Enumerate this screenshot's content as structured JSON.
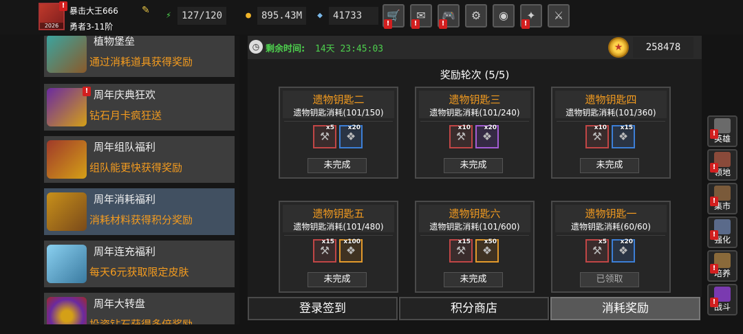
{
  "player": {
    "name": "暴击大王666",
    "rank": "勇者3-11阶",
    "avatar_badge": "2026",
    "energy": "127/120",
    "gold": "895.43M",
    "gems": "41733"
  },
  "top_menu": [
    {
      "icon": "shop-cart-icon",
      "glyph": "🛒",
      "alert": true
    },
    {
      "icon": "mail-icon",
      "glyph": "✉",
      "alert": true
    },
    {
      "icon": "gamepad-icon",
      "glyph": "🎮",
      "alert": true
    },
    {
      "icon": "settings-gear-icon",
      "glyph": "⚙",
      "alert": false
    },
    {
      "icon": "camera-shutter-icon",
      "glyph": "◉",
      "alert": false
    },
    {
      "icon": "fireworks-icon",
      "glyph": "✦",
      "alert": true
    },
    {
      "icon": "crossed-swords-icon",
      "glyph": "⚔",
      "alert": false
    }
  ],
  "events": [
    {
      "title": "植物堡垒",
      "desc": "通过消耗道具获得奖励",
      "thumb": "vase-icon",
      "alert": false,
      "active": false
    },
    {
      "title": "周年庆典狂欢",
      "desc": "钻石月卡疯狂送",
      "thumb": "purple-card-icon",
      "alert": true,
      "active": false
    },
    {
      "title": "周年组队福利",
      "desc": "组队能更快获得奖励",
      "thumb": "treasure-chest-icon",
      "alert": false,
      "active": false
    },
    {
      "title": "周年消耗福利",
      "desc": "消耗材料获得积分奖励",
      "thumb": "gold-chest-icon",
      "alert": false,
      "active": true
    },
    {
      "title": "周年连充福利",
      "desc": "每天6元获取限定皮肤",
      "thumb": "ice-crystal-icon",
      "alert": false,
      "active": false
    },
    {
      "title": "周年大转盘",
      "desc": "投资钻石获得多倍奖励",
      "thumb": "wheel-icon",
      "alert": false,
      "active": false
    }
  ],
  "timer": {
    "label": "剩余时间:",
    "value": "14天 23:45:03"
  },
  "coins": "258478",
  "round_title": "奖励轮次 (5/5)",
  "cards": [
    {
      "name": "遗物钥匙二",
      "progress": "遗物钥匙消耗(101/150)",
      "r1_qty": "x5",
      "r2_qty": "x20",
      "r2_style": "blue",
      "status": "未完成",
      "done": false
    },
    {
      "name": "遗物钥匙三",
      "progress": "遗物钥匙消耗(101/240)",
      "r1_qty": "x10",
      "r2_qty": "x20",
      "r2_style": "purple",
      "status": "未完成",
      "done": false
    },
    {
      "name": "遗物钥匙四",
      "progress": "遗物钥匙消耗(101/360)",
      "r1_qty": "x10",
      "r2_qty": "x15",
      "r2_style": "blue",
      "status": "未完成",
      "done": false
    },
    {
      "name": "遗物钥匙五",
      "progress": "遗物钥匙消耗(101/480)",
      "r1_qty": "x15",
      "r2_qty": "x100",
      "r2_style": "orange",
      "status": "未完成",
      "done": false
    },
    {
      "name": "遗物钥匙六",
      "progress": "遗物钥匙消耗(101/600)",
      "r1_qty": "x15",
      "r2_qty": "x50",
      "r2_style": "orange",
      "status": "未完成",
      "done": false
    },
    {
      "name": "遗物钥匙一",
      "progress": "遗物钥匙消耗(60/60)",
      "r1_qty": "x5",
      "r2_qty": "x20",
      "r2_style": "blue",
      "status": "已领取",
      "done": true
    }
  ],
  "tabs": [
    {
      "label": "登录签到",
      "active": false
    },
    {
      "label": "积分商店",
      "active": false
    },
    {
      "label": "消耗奖励",
      "active": true
    }
  ],
  "side_buttons": [
    {
      "label": "英雄",
      "icon": "hero-helmet-icon",
      "color": "#6a6a6a",
      "alert": true
    },
    {
      "label": "领地",
      "icon": "castle-icon",
      "color": "#8a4a3a",
      "alert": true
    },
    {
      "label": "集市",
      "icon": "market-stall-icon",
      "color": "#7a5a3a",
      "alert": true
    },
    {
      "label": "强化",
      "icon": "rune-icon",
      "color": "#5a6a8a",
      "alert": true
    },
    {
      "label": "培养",
      "icon": "potion-icon",
      "color": "#8a6a3a",
      "alert": true
    },
    {
      "label": "战斗",
      "icon": "portal-icon",
      "color": "#7a3ab0",
      "alert": true
    }
  ]
}
